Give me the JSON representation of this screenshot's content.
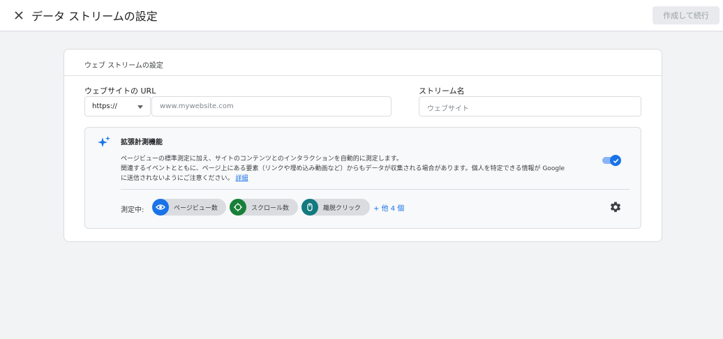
{
  "header": {
    "title": "データ ストリームの設定",
    "create_button_label": "作成して続行"
  },
  "card": {
    "heading": "ウェブ ストリームの設定",
    "url_label": "ウェブサイトの URL",
    "protocol_value": "https://",
    "url_placeholder": "www.mywebsite.com",
    "stream_name_label": "ストリーム名",
    "stream_name_placeholder": "ウェブサイト"
  },
  "enhanced": {
    "title": "拡張計測機能",
    "description_line1": "ページビューの標準測定に加え、サイトのコンテンツとのインタラクションを自動的に測定します。",
    "description_line2": "関連するイベントとともに、ページ上にある要素（リンクや埋め込み動画など）からもデータが収集される場合があります。個人を特定できる情報が Google に送信されないようにご注意ください。",
    "details_link": "詳細",
    "toggle_on": true,
    "measuring_label": "測定中:",
    "chips": [
      {
        "label": "ページビュー数",
        "icon": "eye-icon",
        "color": "#1a73e8"
      },
      {
        "label": "スクロール数",
        "icon": "crosshair-icon",
        "color": "#188038"
      },
      {
        "label": "離脱クリック",
        "icon": "mouse-icon",
        "color": "#137a7f"
      }
    ],
    "more_link": "+ 他 4 個"
  }
}
